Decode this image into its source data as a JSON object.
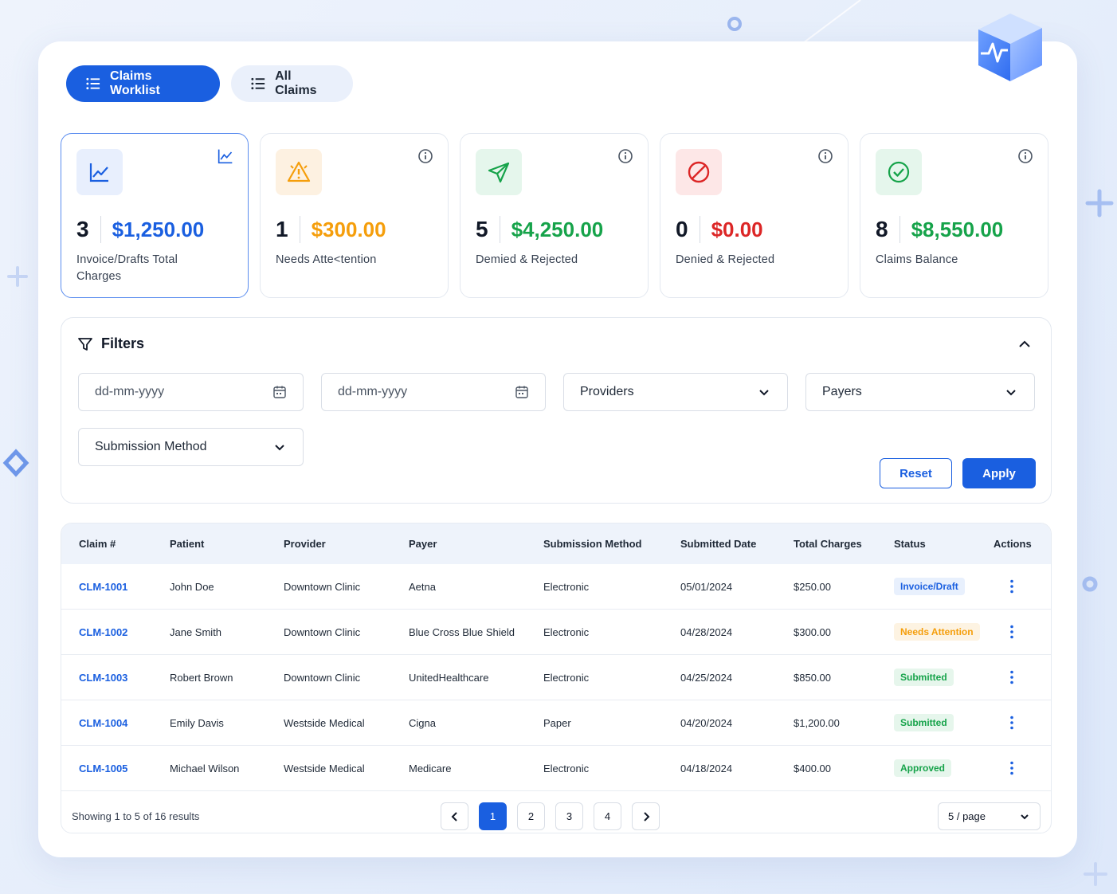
{
  "tabs": [
    {
      "label": "Claims Worklist",
      "active": true
    },
    {
      "label": "All Claims",
      "active": false
    }
  ],
  "stats": [
    {
      "count": "3",
      "amount": "$1,250.00",
      "label_line1": "Invoice/Drafts Total",
      "label_line2": "Charges",
      "color": "#1a5fe0",
      "icon": "trend-chart-icon",
      "corner_icon": "chart-icon"
    },
    {
      "count": "1",
      "amount": "$300.00",
      "label_line1": "Needs Atte<tention",
      "label_line2": "",
      "color": "#f59e0b",
      "icon": "warning-icon",
      "corner_icon": "info-icon"
    },
    {
      "count": "5",
      "amount": "$4,250.00",
      "label_line1": "Demied & Rejected",
      "label_line2": "",
      "color": "#16a34a",
      "icon": "send-icon",
      "corner_icon": "info-icon"
    },
    {
      "count": "0",
      "amount": "$0.00",
      "label_line1": "Denied & Rejected",
      "label_line2": "",
      "color": "#dc2626",
      "icon": "ban-icon",
      "corner_icon": "info-icon"
    },
    {
      "count": "8",
      "amount": "$8,550.00",
      "label_line1": "Claims Balance",
      "label_line2": "",
      "color": "#16a34a",
      "icon": "check-circle-icon",
      "corner_icon": "info-icon"
    }
  ],
  "filters": {
    "title": "Filters",
    "date_from_placeholder": "dd-mm-yyyy",
    "date_to_placeholder": "dd-mm-yyyy",
    "providers": "Providers",
    "payers": "Payers",
    "submission_method": "Submission Method",
    "reset_label": "Reset",
    "apply_label": "Apply"
  },
  "table": {
    "headers": [
      "Claim #",
      "Patient",
      "Provider",
      "Payer",
      "Submission Method",
      "Submitted Date",
      "Total Charges",
      "Status",
      "Actions"
    ],
    "rows": [
      {
        "claim": "CLM-1001",
        "patient": "John Doe",
        "provider": "Downtown Clinic",
        "payer": "Aetna",
        "method": "Electronic",
        "date": "05/01/2024",
        "total": "$250.00",
        "status": "Invoice/Draft"
      },
      {
        "claim": "CLM-1002",
        "patient": "Jane Smith",
        "provider": "Downtown Clinic",
        "payer": "Blue Cross Blue Shield",
        "method": "Electronic",
        "date": "04/28/2024",
        "total": "$300.00",
        "status": "Needs Attention"
      },
      {
        "claim": "CLM-1003",
        "patient": "Robert Brown",
        "provider": "Downtown Clinic",
        "payer": "UnitedHealthcare",
        "method": "Electronic",
        "date": "04/25/2024",
        "total": "$850.00",
        "status": "Submitted"
      },
      {
        "claim": "CLM-1004",
        "patient": "Emily Davis",
        "provider": "Westside Medical",
        "payer": "Cigna",
        "method": "Paper",
        "date": "04/20/2024",
        "total": "$1,200.00",
        "status": "Submitted"
      },
      {
        "claim": "CLM-1005",
        "patient": "Michael Wilson",
        "provider": "Westside Medical",
        "payer": "Medicare",
        "method": "Electronic",
        "date": "04/18/2024",
        "total": "$400.00",
        "status": "Approved"
      }
    ],
    "status_colors": {
      "Invoice/Draft": {
        "fg": "#1a5fe0",
        "bg": "#e8f0fd"
      },
      "Needs Attention": {
        "fg": "#f59e0b",
        "bg": "#fdf3e2"
      },
      "Submitted": {
        "fg": "#16a34a",
        "bg": "#e6f6ec"
      },
      "Approved": {
        "fg": "#16a34a",
        "bg": "#e6f6ec"
      }
    }
  },
  "pagination": {
    "info": "Showing 1 to 5 of 16 results",
    "pages": [
      "1",
      "2",
      "3",
      "4"
    ],
    "current": "1",
    "per_page": "5 / page"
  }
}
